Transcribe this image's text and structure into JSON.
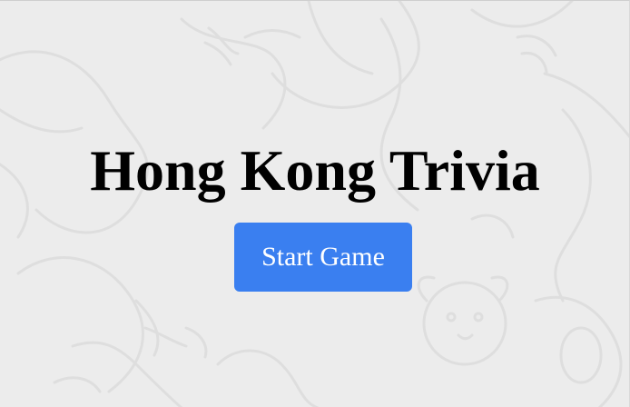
{
  "page": {
    "title": "Hong Kong Trivia"
  },
  "actions": {
    "start_label": "Start Game"
  },
  "colors": {
    "background": "#ececec",
    "pattern_stroke": "#dedede",
    "button": "#3a7ff0",
    "button_text": "#ffffff",
    "title_text": "#000000"
  }
}
